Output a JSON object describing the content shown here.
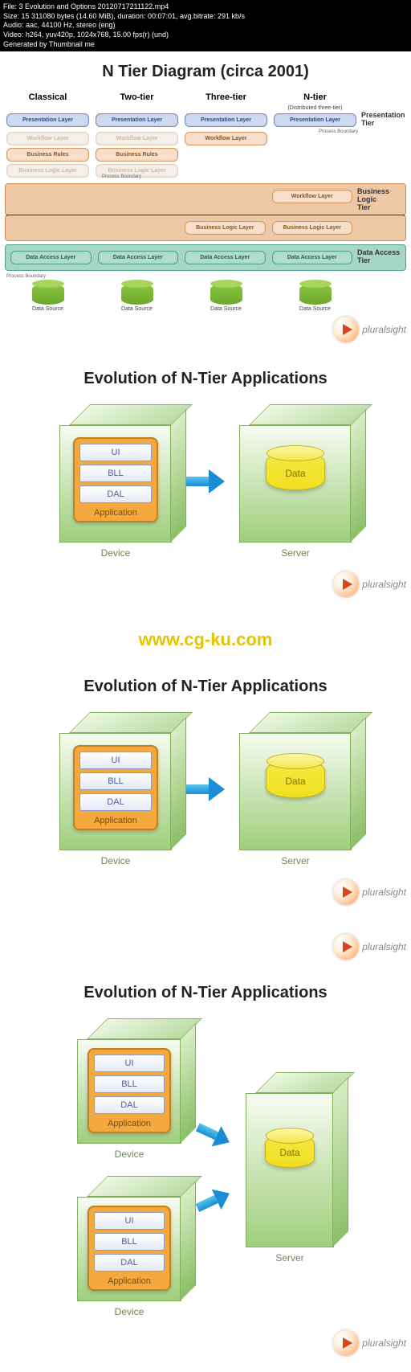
{
  "meta": {
    "file": "File: 3 Evolution and Options 20120717211122.mp4",
    "size": "Size: 15 311080 bytes (14.60 MiB), duration: 00:07:01, avg.bitrate: 291 kb/s",
    "audio": "Audio: aac, 44100 Hz, stereo (eng)",
    "video": "Video: h264, yuv420p, 1024x768, 15.00 fps(r) (und)",
    "gen": "Generated by Thumbnail me"
  },
  "watermark": "www.cg-ku.com",
  "brand": "pluralsight",
  "slide1": {
    "title": "N Tier Diagram (circa 2001)",
    "cols": [
      {
        "head": "Classical",
        "sub": ""
      },
      {
        "head": "Two-tier",
        "sub": ""
      },
      {
        "head": "Three-tier",
        "sub": ""
      },
      {
        "head": "N-tier",
        "sub": "(Distributed three-tier)"
      }
    ],
    "layers": {
      "presentation": "Presentation Layer",
      "workflow": "Workflow Layer",
      "business_rules": "Business Rules",
      "business_logic": "Business Logic Layer",
      "data_access": "Data Access Layer"
    },
    "tiers": {
      "pres": "Presentation\nTier",
      "biz": "Business Logic\nTier",
      "data": "Data Access\nTier"
    },
    "pb": "Process\nBoundary",
    "ds": "Data Source"
  },
  "evo": {
    "title": "Evolution of N-Tier Applications",
    "layers": {
      "ui": "UI",
      "bll": "BLL",
      "dal": "DAL"
    },
    "app": "Application",
    "device": "Device",
    "server": "Server",
    "data": "Data"
  }
}
